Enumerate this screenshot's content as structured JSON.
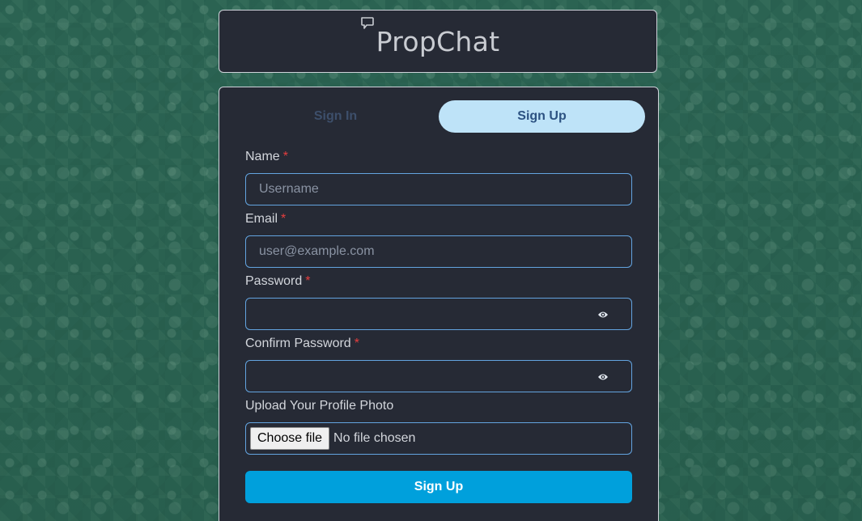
{
  "app": {
    "title": "PropChat",
    "logo_icon": "chat-bubble-icon"
  },
  "tabs": [
    {
      "label": "Sign In",
      "active": false
    },
    {
      "label": "Sign Up",
      "active": true
    }
  ],
  "form": {
    "name": {
      "label": "Name",
      "required_mark": "*",
      "placeholder": "Username",
      "value": ""
    },
    "email": {
      "label": "Email",
      "required_mark": "*",
      "placeholder": "user@example.com",
      "value": ""
    },
    "password": {
      "label": "Password",
      "required_mark": "*",
      "value": "",
      "toggle_icon": "eye-icon"
    },
    "confirm_password": {
      "label": "Confirm Password",
      "required_mark": "*",
      "value": "",
      "toggle_icon": "eye-icon"
    },
    "photo": {
      "label": "Upload Your Profile Photo",
      "button_label": "Choose file",
      "status": "No file chosen"
    },
    "submit_label": "Sign Up"
  },
  "colors": {
    "background": "#2f6a59",
    "card": "#262a35",
    "accent": "#00a0dc",
    "active_tab": "#bee3f8",
    "required": "#e53e3e",
    "input_border": "#63a4e0"
  }
}
